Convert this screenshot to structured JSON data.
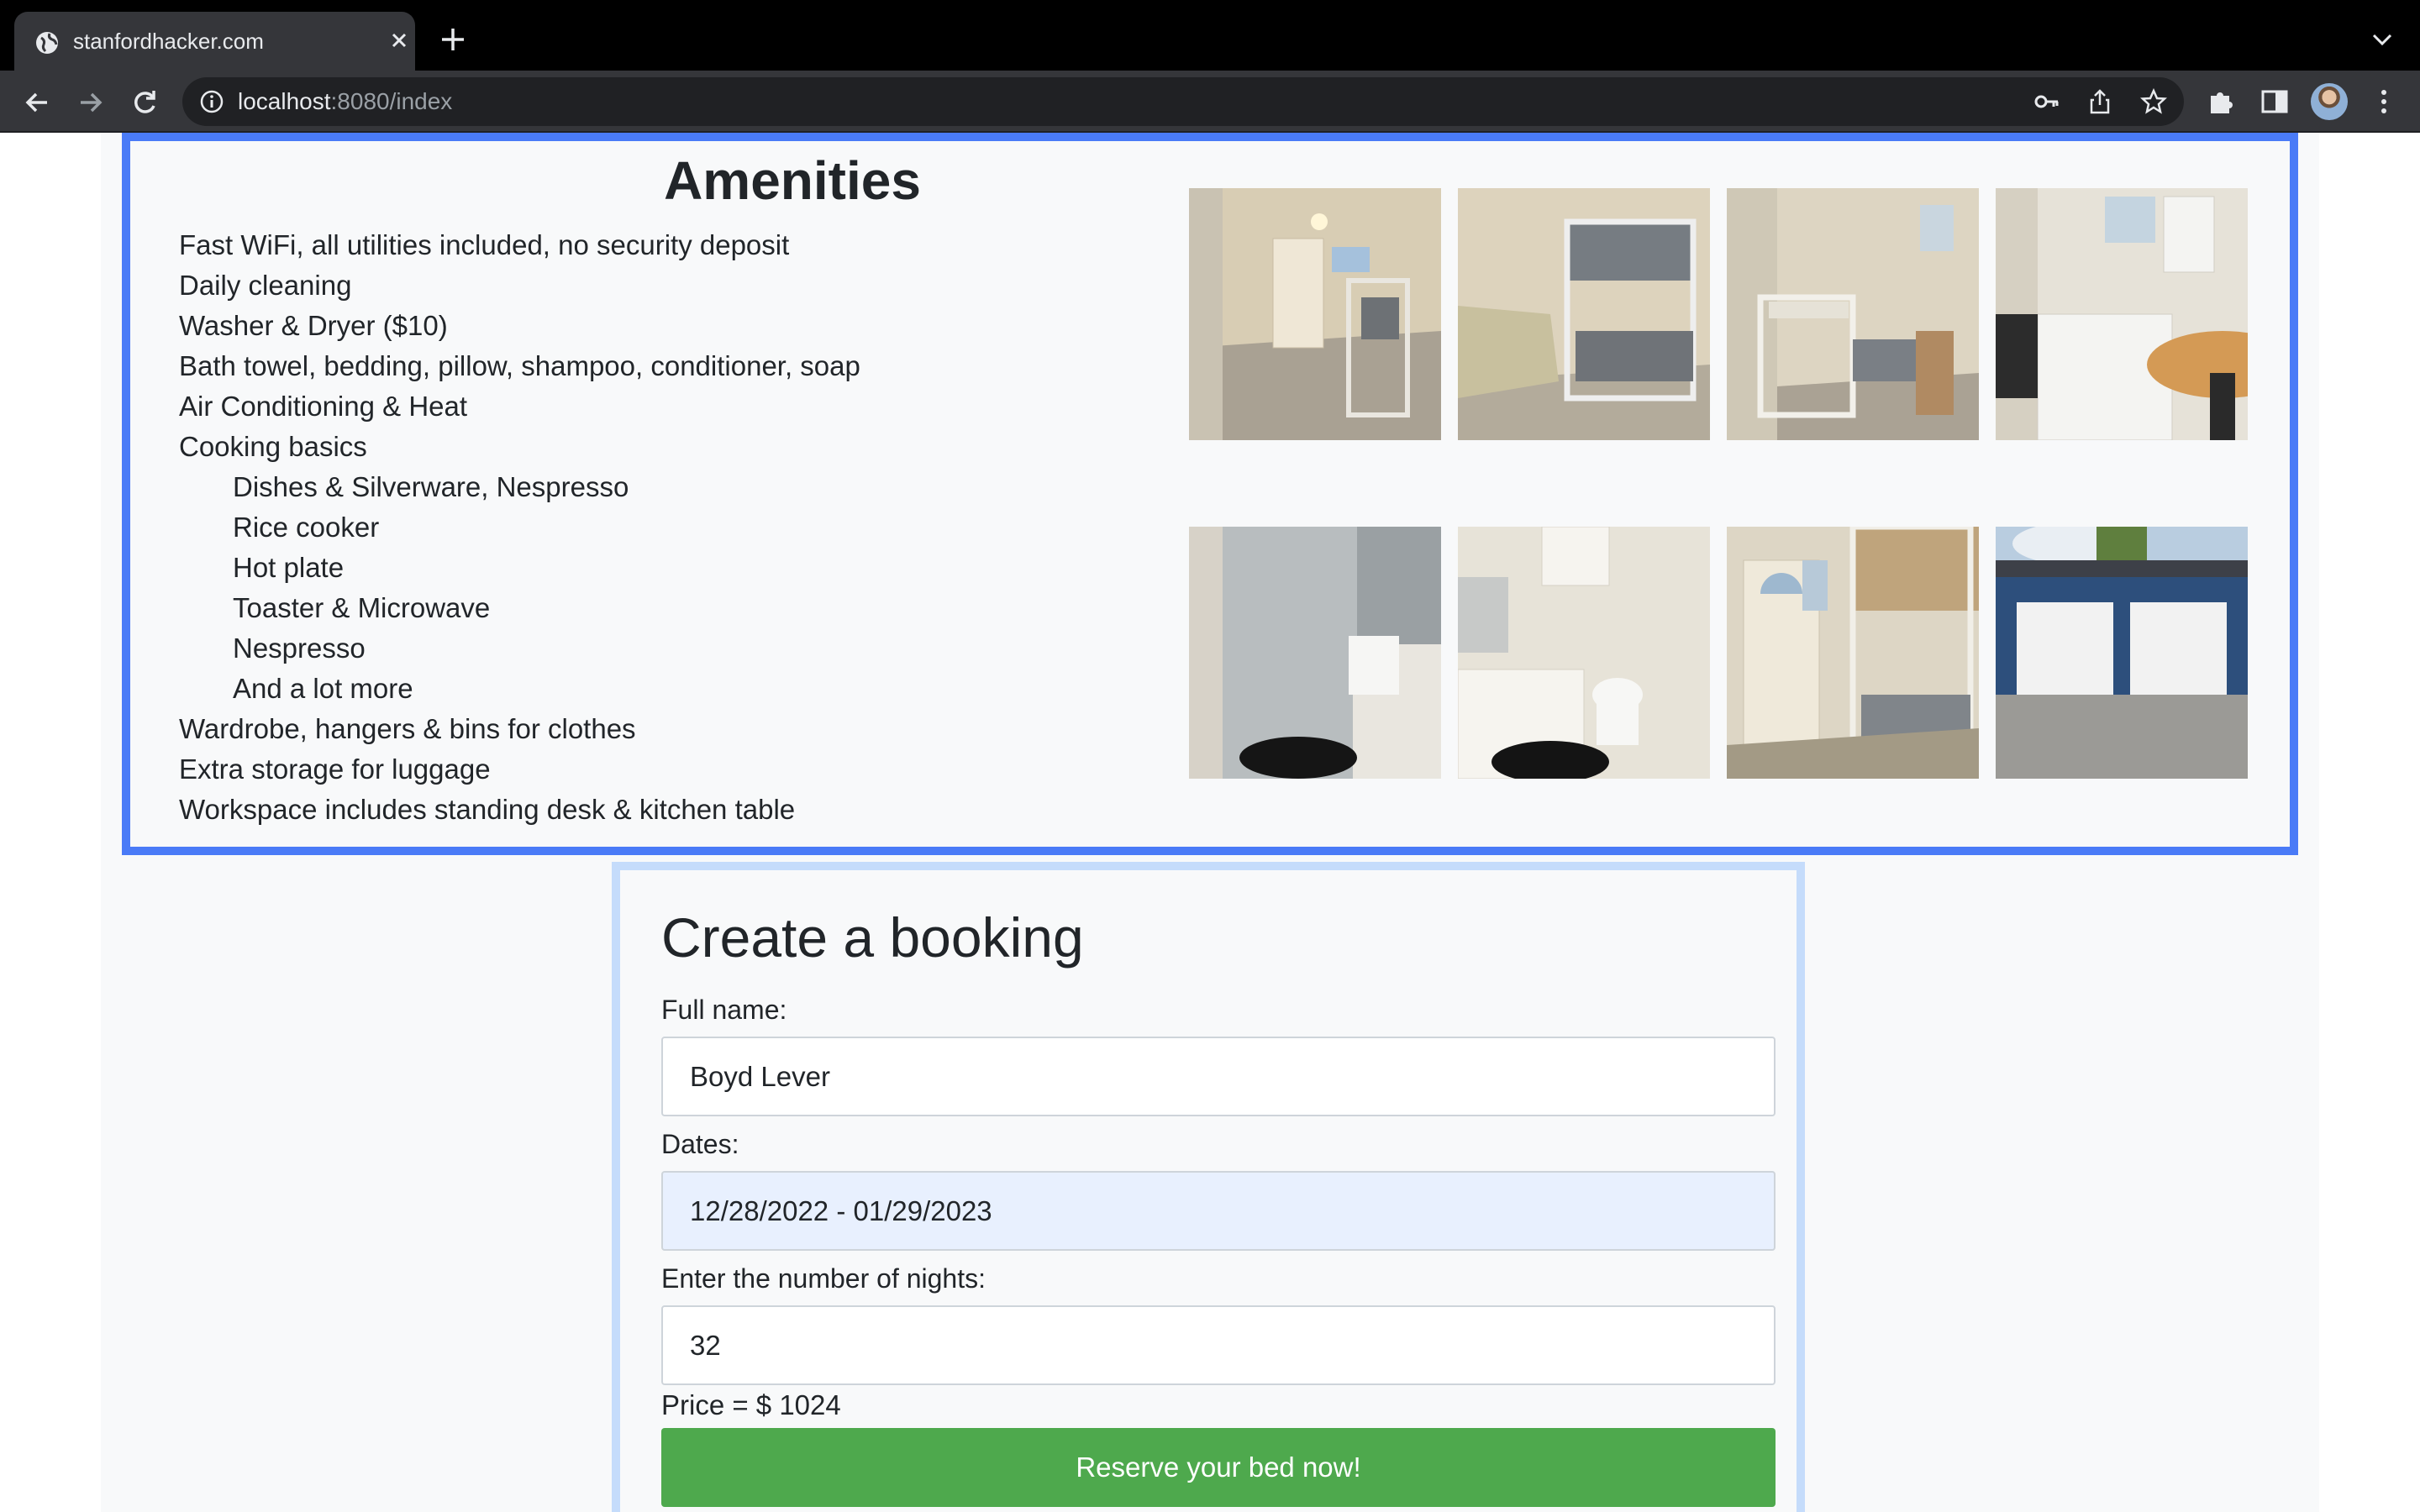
{
  "browser": {
    "tab_title": "stanfordhacker.com",
    "url_host": "localhost",
    "url_path": ":8080/index"
  },
  "icons": {
    "tab": "globe-icon",
    "close": "close-icon",
    "new_tab": "plus-icon",
    "back": "arrow-left-icon",
    "forward": "arrow-right-icon",
    "reload": "reload-icon",
    "site_info": "info-icon",
    "password": "key-icon",
    "share": "share-icon",
    "bookmark": "star-icon",
    "extensions": "puzzle-icon",
    "side_panel": "side-panel-icon",
    "menu": "kebab-menu-icon"
  },
  "amenities": {
    "title": "Amenities",
    "items": [
      {
        "text": "Fast WiFi, all utilities included, no security deposit",
        "sub": false
      },
      {
        "text": "Daily cleaning",
        "sub": false
      },
      {
        "text": "Washer & Dryer ($10)",
        "sub": false
      },
      {
        "text": "Bath towel, bedding, pillow, shampoo, conditioner, soap",
        "sub": false
      },
      {
        "text": "Air Conditioning & Heat",
        "sub": false
      },
      {
        "text": "Cooking basics",
        "sub": false
      },
      {
        "text": "Dishes & Silverware, Nespresso",
        "sub": true
      },
      {
        "text": "Rice cooker",
        "sub": true
      },
      {
        "text": "Hot plate",
        "sub": true
      },
      {
        "text": "Toaster & Microwave",
        "sub": true
      },
      {
        "text": "Nespresso",
        "sub": true
      },
      {
        "text": "And a lot more",
        "sub": true
      },
      {
        "text": "Wardrobe, hangers & bins for clothes",
        "sub": false
      },
      {
        "text": "Extra storage for luggage",
        "sub": false
      },
      {
        "text": "Workspace includes standing desk & kitchen table",
        "sub": false
      }
    ],
    "photos": [
      "room-photo",
      "bunk-bed-photo",
      "bunk-bed-photo",
      "kitchen-photo",
      "shower-photo",
      "bathroom-photo",
      "entry-door-photo",
      "garage-photo"
    ]
  },
  "booking": {
    "title": "Create a booking",
    "name_label": "Full name:",
    "name_value": "Boyd Lever",
    "dates_label": "Dates:",
    "dates_value": "12/28/2022 - 01/29/2023",
    "nights_label": "Enter the number of nights:",
    "nights_value": "32",
    "price_text": "Price = $ 1024",
    "reserve_label": "Reserve your bed now!"
  },
  "colors": {
    "amenities_border": "#4a7bf7",
    "booking_border": "#c5dcfb",
    "reserve_button": "#4ea94d",
    "autofill_field": "#e8f0fe"
  }
}
